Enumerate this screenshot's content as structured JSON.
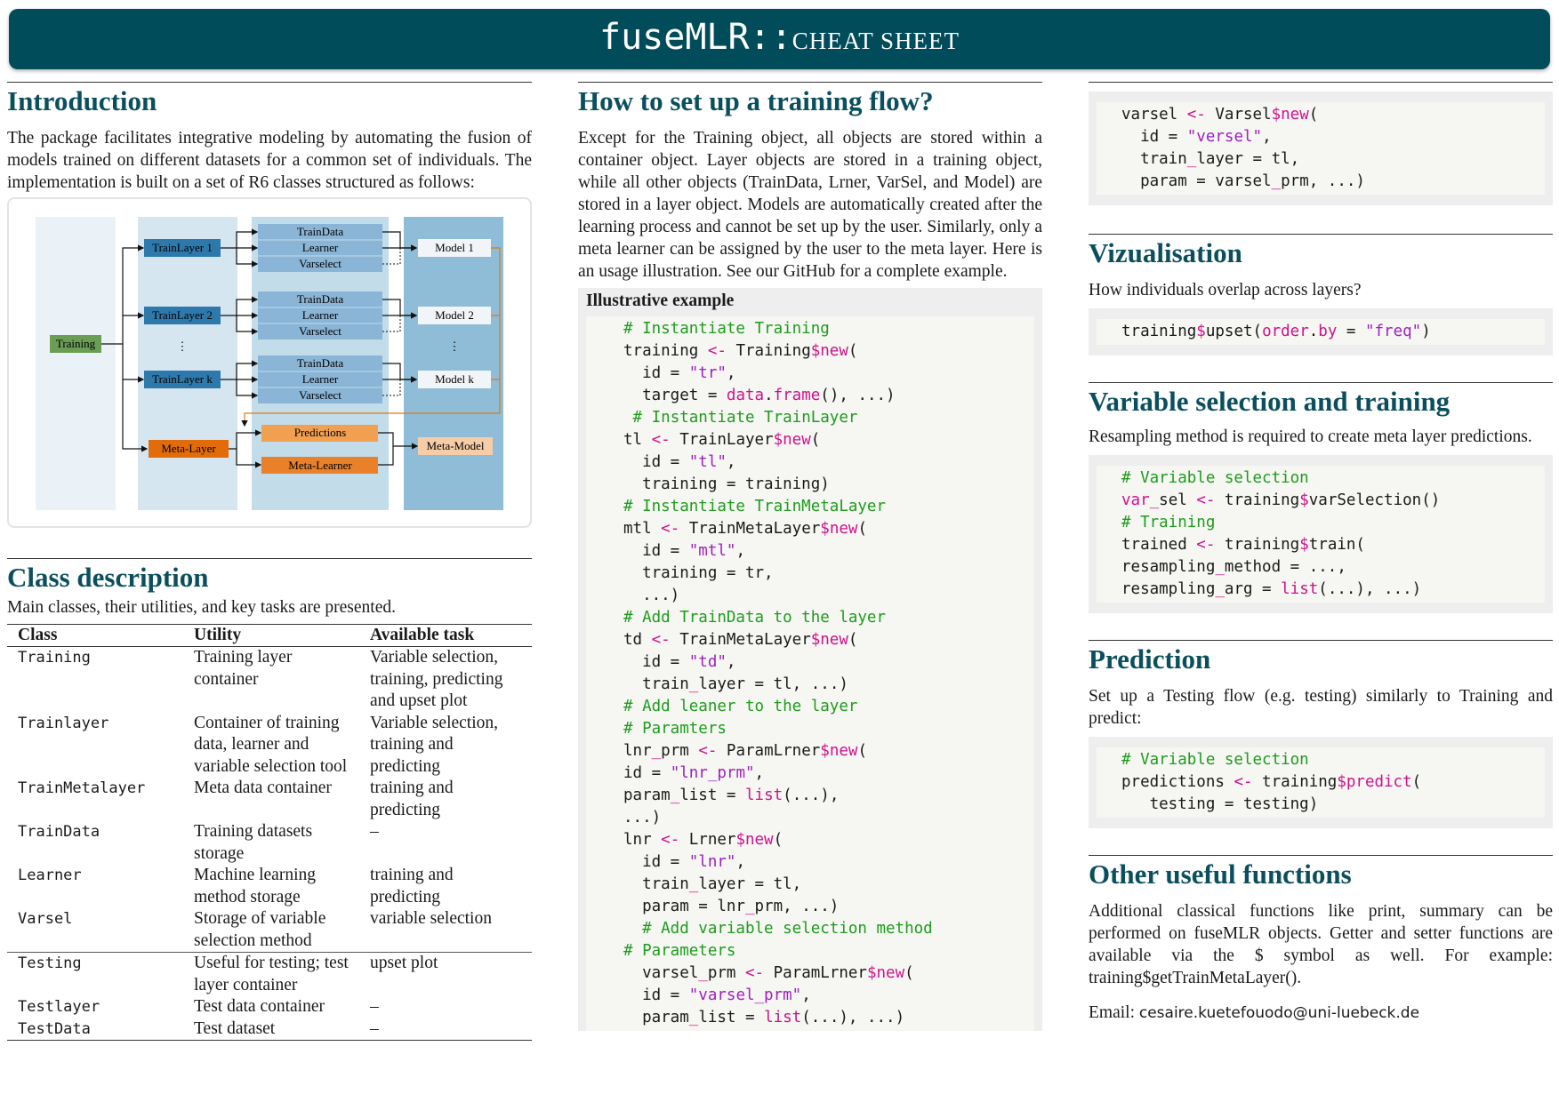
{
  "title": {
    "mono": "fuseMLR::",
    "sc": "CHEAT SHEET"
  },
  "intro": {
    "heading": "Introduction",
    "text": "The package facilitates integrative modeling by automating the fusion of models trained on different datasets for a common set of individuals. The implementation is built on a set of R6 classes structured as follows:"
  },
  "diagram": {
    "training": "Training",
    "train_layers": [
      "TrainLayer 1",
      "TrainLayer 2",
      "TrainLayer k"
    ],
    "components": [
      "TrainData",
      "Learner",
      "Varselect"
    ],
    "models": [
      "Model 1",
      "Model 2",
      "Model k"
    ],
    "meta_layer": "Meta-Layer",
    "predictions": "Predictions",
    "meta_learner": "Meta-Learner",
    "meta_model": "Meta-Model",
    "dots": "⋮"
  },
  "classes": {
    "heading": "Class description",
    "intro": "Main classes, their utilities, and key tasks are presented.",
    "columns": [
      "Class",
      "Utility",
      "Available task"
    ],
    "rows": [
      [
        "Training",
        "Training layer container",
        "Variable selection, training, predicting and upset plot"
      ],
      [
        "Trainlayer",
        "Container of training data, learner and variable selection tool",
        "Variable selection, training and predicting"
      ],
      [
        "TrainMetalayer",
        "Meta data container",
        "training and predicting"
      ],
      [
        "TrainData",
        "Training datasets storage",
        "–"
      ],
      [
        "Learner",
        "Machine learning method storage",
        "training and predicting"
      ],
      [
        "Varsel",
        "Storage of variable selection method",
        "variable selection"
      ],
      [
        "Testing",
        "Useful for testing; test layer container",
        "upset plot"
      ],
      [
        "Testlayer",
        "Test data container",
        "–"
      ],
      [
        "TestData",
        "Test dataset",
        "–"
      ]
    ]
  },
  "flow": {
    "heading": "How to set up a training flow?",
    "text": "Except for the Training object, all objects are stored within a container object. Layer objects are stored in a training object, while all other objects (TrainData, Lrner, VarSel, and Model) are stored in a layer object. Models are automatically created after the learning process and cannot be set up by the user. Similarly, only a meta learner can be assigned by the user to the meta layer. Here is an usage illustration. See our GitHub for a complete example.",
    "example_title": "Illustrative example"
  },
  "viz": {
    "heading": "Vizualisation",
    "text": "How individuals overlap across layers?"
  },
  "varsel_train": {
    "heading": "Variable selection and training",
    "text": "Resampling method is required to create meta layer predictions."
  },
  "prediction": {
    "heading": "Prediction",
    "text": "Set up a Testing flow (e.g. testing) similarly to Training and predict:"
  },
  "other": {
    "heading": "Other useful functions",
    "text": "Additional classical functions like print, summary can be performed on fuseMLR objects. Getter and setter functions are available via the $ symbol as well. For example: training$getTrainMetaLayer().",
    "email_label": "Email:",
    "email": "cesaire.kuetefouodo@uni-luebeck.de"
  },
  "colors": {
    "banner": "#014c5a",
    "heading": "#0b4f5e",
    "comment": "#1e9c1e",
    "operator": "#d0118c",
    "string": "#a020c0"
  }
}
